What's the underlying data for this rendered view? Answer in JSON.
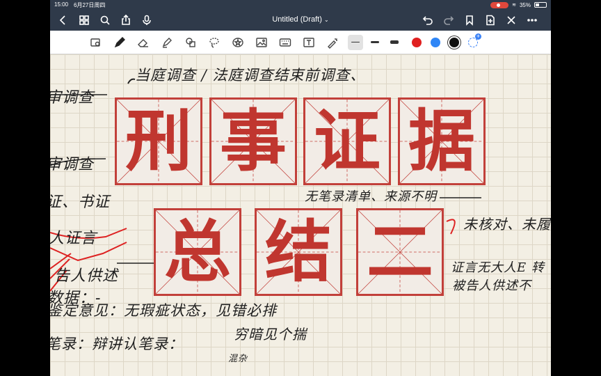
{
  "status_bar": {
    "time": "15:00",
    "date": "6月27日周四",
    "battery": "35%",
    "battery_level": 0.35
  },
  "nav": {
    "title": "Untitled (Draft)"
  },
  "toolbar": {
    "tools": [
      "zoom-lasso",
      "pen",
      "eraser",
      "highlighter",
      "shapes",
      "lasso",
      "elements",
      "image",
      "keyboard",
      "text",
      "laser"
    ],
    "stroke_widths": [
      "thin",
      "medium",
      "thick"
    ],
    "colors": [
      "#e02020",
      "#2f86f6",
      "#111111"
    ],
    "selected_color": "#111111"
  },
  "notes": {
    "line1": "当庭调查 / 法庭调查结束前调查、",
    "line2": "审调查",
    "line3": "审调查",
    "line4": "证、书证",
    "line5": "无笔录清单、来源不明",
    "line6": "人证言",
    "line7": "未核对、未履",
    "line8": "告人供述",
    "line9": "证言无大人E 转",
    "line10": "数据：-",
    "line11": "被告人供述不",
    "line12": "鉴定意见：无瑕疵状态，见错必排",
    "line13": "笔录：辩讲认笔录：",
    "line14": "穷暗见个揣",
    "line15": "混杂"
  },
  "title_tiles": {
    "row1": [
      "刑",
      "事",
      "证",
      "据"
    ],
    "row2": [
      "总",
      "结",
      "二"
    ]
  }
}
